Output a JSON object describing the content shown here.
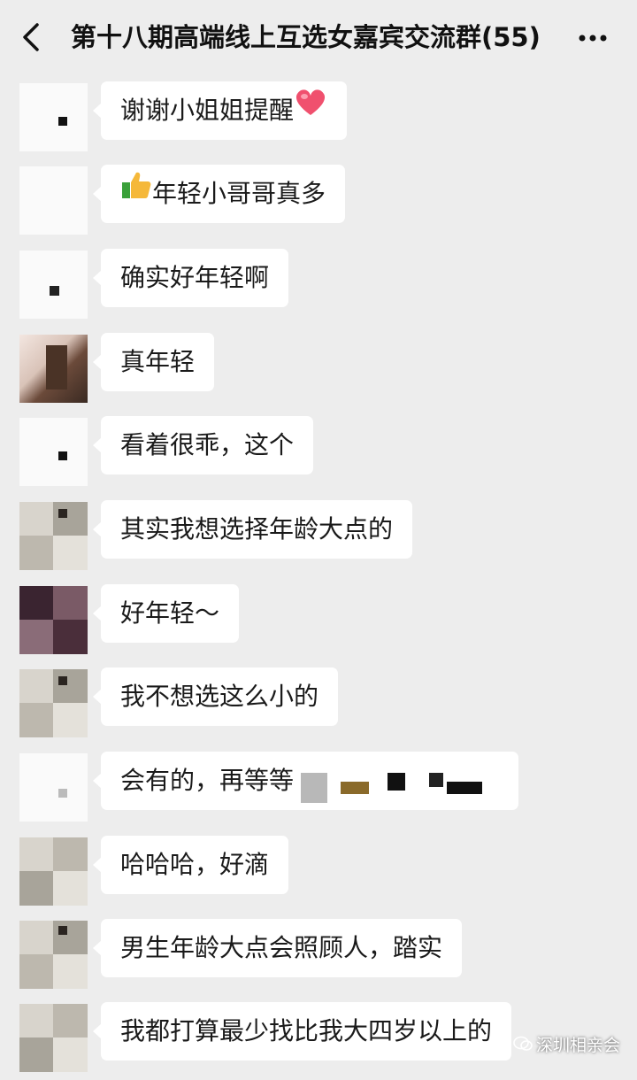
{
  "header": {
    "title": "第十八期高端线上互选女嘉宾交流群(55)"
  },
  "messages": [
    {
      "text": "谢谢小姐姐提醒",
      "suffix_emoji": "heart"
    },
    {
      "text": "年轻小哥哥真多",
      "prefix_emoji": "thumbs-up"
    },
    {
      "text": "确实好年轻啊"
    },
    {
      "text": "真年轻"
    },
    {
      "text": "看着很乖，这个"
    },
    {
      "text": "其实我想选择年龄大点的"
    },
    {
      "text": "好年轻～"
    },
    {
      "text": "我不想选这么小的"
    },
    {
      "text": "会有的，再等等"
    },
    {
      "text": "哈哈哈，好滴"
    },
    {
      "text": "男生年龄大点会照顾人，踏实"
    },
    {
      "text": "我都打算最少找比我大四岁以上的"
    }
  ],
  "watermark": {
    "text": "深圳相亲会"
  },
  "icons": [
    "back-chevron-icon",
    "more-dots-icon",
    "heart-icon",
    "thumbs-up-icon",
    "wechat-icon"
  ],
  "colors": {
    "background": "#ededed",
    "bubble": "#ffffff",
    "text": "#1a1a1a",
    "heart": "#f0506e",
    "thumb": "#f5b83a"
  }
}
